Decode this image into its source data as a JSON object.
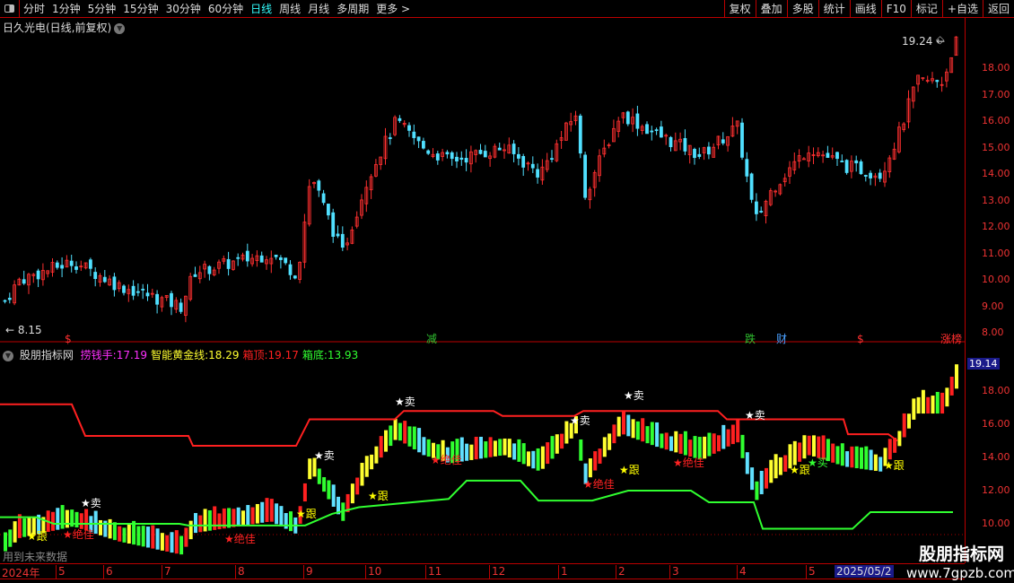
{
  "toolbar": {
    "periods": [
      "分时",
      "1分钟",
      "5分钟",
      "15分钟",
      "30分钟",
      "60分钟",
      "日线",
      "周线",
      "月线",
      "多周期",
      "更多 >"
    ],
    "active_period": "日线",
    "buttons": [
      "复权",
      "叠加",
      "多股",
      "统计",
      "画线",
      "F10",
      "标记",
      "+自选",
      "返回"
    ]
  },
  "main": {
    "title": "日久光电(日线,前复权)",
    "high_label": "19.24",
    "low_label": "8.15",
    "price_ticks": [
      "18.00",
      "17.00",
      "16.00",
      "15.00",
      "14.00",
      "13.00",
      "12.00",
      "11.00",
      "10.00",
      "9.00",
      "8.00"
    ],
    "event_tags": [
      {
        "text": "$",
        "color": "#ff3030"
      },
      {
        "text": "减",
        "color": "#30c030"
      },
      {
        "text": "跌",
        "color": "#30c030"
      },
      {
        "text": "财",
        "color": "#4aa0ff"
      },
      {
        "text": "$",
        "color": "#ff3030"
      },
      {
        "text": "涨榜",
        "color": "#ff3030"
      }
    ],
    "price_trend": [
      [
        0,
        9
      ],
      [
        20,
        10
      ],
      [
        80,
        10.7
      ],
      [
        130,
        9.8
      ],
      [
        200,
        9
      ],
      [
        215,
        10.3
      ],
      [
        300,
        11
      ],
      [
        330,
        10.2
      ],
      [
        345,
        14
      ],
      [
        380,
        11
      ],
      [
        410,
        14
      ],
      [
        440,
        16
      ],
      [
        470,
        15
      ],
      [
        500,
        14.5
      ],
      [
        560,
        15
      ],
      [
        600,
        14
      ],
      [
        640,
        16.3
      ],
      [
        650,
        13.2
      ],
      [
        690,
        16.3
      ],
      [
        730,
        15.5
      ],
      [
        780,
        14.7
      ],
      [
        820,
        15.8
      ],
      [
        840,
        12.2
      ],
      [
        860,
        13.5
      ],
      [
        900,
        15
      ],
      [
        940,
        14.3
      ],
      [
        980,
        14
      ],
      [
        1000,
        15.5
      ],
      [
        1020,
        17.5
      ],
      [
        1050,
        17.5
      ],
      [
        1062,
        19
      ]
    ]
  },
  "indicator": {
    "name": "股朋指标网",
    "items": [
      {
        "label": "捞钱手:",
        "value": "17.19",
        "color": "#ff30ff"
      },
      {
        "label": "智能黄金线:",
        "value": "18.29",
        "color": "#ffff30"
      },
      {
        "label": "箱顶:",
        "value": "19.17",
        "color": "#ff2020"
      },
      {
        "label": "箱底:",
        "value": "13.93",
        "color": "#30ff30"
      }
    ],
    "current_value": "19.14",
    "ticks": [
      "18.00",
      "16.00",
      "14.00",
      "12.00",
      "10.00"
    ],
    "signals": [
      "★卖",
      "★跟",
      "★绝佳",
      "★买"
    ],
    "future_text": "用到未来数据"
  },
  "dateaxis": {
    "months": [
      "2024年",
      "5",
      "6",
      "7",
      "8",
      "9",
      "10",
      "11",
      "12",
      "1",
      "2",
      "3",
      "4",
      "5"
    ],
    "current_date": "2025/05/2"
  },
  "watermark": {
    "name": "股朋指标网",
    "url": "www.7gpzb.com"
  }
}
